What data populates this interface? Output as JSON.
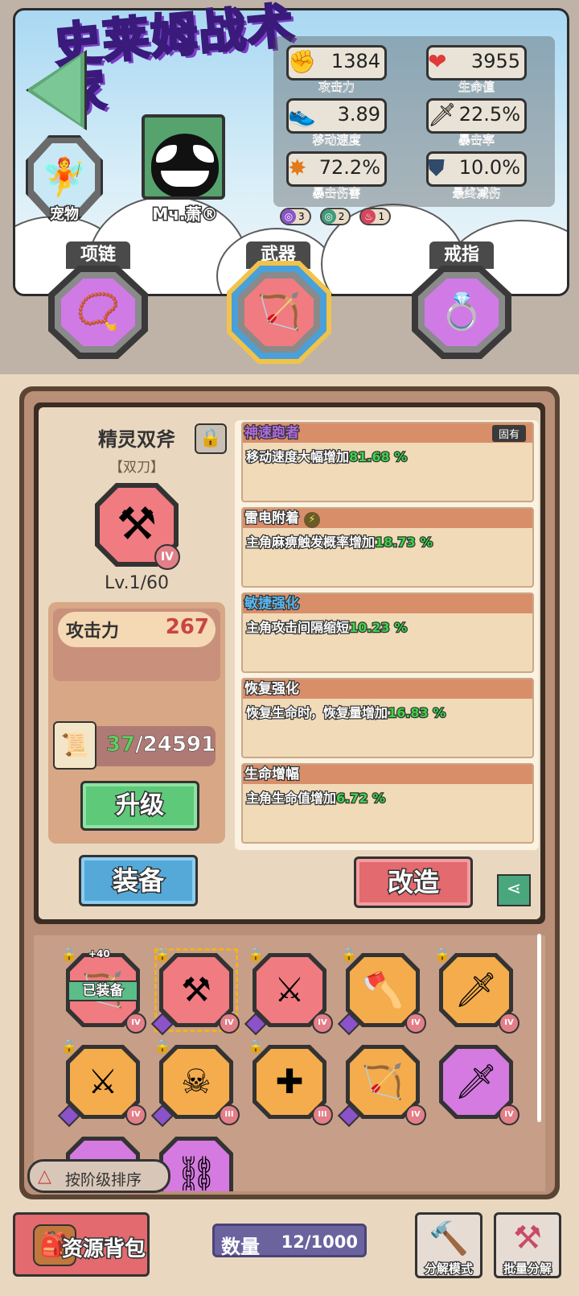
{
  "header": {
    "logo_text": "史莱姆战术家",
    "pet_label": "宠物",
    "player_name": "Mч.萧®"
  },
  "stats": [
    {
      "icon": "fist-icon",
      "value": "1384",
      "label": "攻击力"
    },
    {
      "icon": "heart-icon",
      "value": "3955",
      "label": "生命值"
    },
    {
      "icon": "shoe-icon",
      "value": "3.89",
      "label": "移动速度"
    },
    {
      "icon": "sword-icon",
      "value": "22.5%",
      "label": "暴击率"
    },
    {
      "icon": "explosion-icon",
      "value": "72.2%",
      "label": "暴击伤害"
    },
    {
      "icon": "shield-icon",
      "value": "10.0%",
      "label": "最终减伤"
    }
  ],
  "buffs": [
    {
      "icon": "purple-swirl-icon",
      "count": "3",
      "color": "#8b52c9"
    },
    {
      "icon": "green-swirl-icon",
      "count": "2",
      "color": "#3f9a7a"
    },
    {
      "icon": "fire-icon",
      "count": "1",
      "color": "#d6455d"
    }
  ],
  "equip_slots": [
    {
      "label": "项链",
      "icon": "necklace-icon"
    },
    {
      "label": "武器",
      "icon": "bow-icon"
    },
    {
      "label": "戒指",
      "icon": "ring-icon"
    }
  ],
  "detail": {
    "name": "精灵双斧",
    "type": "【双刀】",
    "tier": "IV",
    "level": "Lv.1/60",
    "attack_label": "攻击力",
    "attack_value": "267",
    "material_have": "37",
    "material_need": "/24591",
    "upgrade_label": "升级",
    "equip_label": "装备",
    "reforge_label": "改造"
  },
  "affixes": [
    {
      "name": "神速跑者",
      "desc": "移动速度大幅增加",
      "value": "81.68 %",
      "tag": "固有",
      "name_color": "#b06ae0"
    },
    {
      "name": "雷电附着",
      "desc": "主角麻痹触发概率增加",
      "value": "18.73 %",
      "tag": "",
      "name_color": "#ffffff"
    },
    {
      "name": "敏捷强化",
      "desc": "主角攻击间隔缩短",
      "value": "10.23 %",
      "tag": "",
      "name_color": "#59b8f0"
    },
    {
      "name": "恢复强化",
      "desc": "恢复生命时，恢复量增加",
      "value": "16.83 %",
      "tag": "",
      "name_color": "#ffffff"
    },
    {
      "name": "生命增幅",
      "desc": "主角生命值增加",
      "value": "6.72 %",
      "tag": "",
      "name_color": "#ffffff"
    }
  ],
  "inventory": [
    {
      "icon": "bow-icon",
      "tier": "IV",
      "bg": "#f07b80",
      "equipped": "已装备",
      "plus": "+40"
    },
    {
      "icon": "axes-icon",
      "tier": "IV",
      "bg": "#f07b80"
    },
    {
      "icon": "green-swords-icon",
      "tier": "IV",
      "bg": "#f07b80"
    },
    {
      "icon": "halberd-icon",
      "tier": "IV",
      "bg": "#f4ac4c"
    },
    {
      "icon": "katana-icon",
      "tier": "IV",
      "bg": "#f4ac4c"
    },
    {
      "icon": "twin-swords-icon",
      "tier": "IV",
      "bg": "#f4ac4c"
    },
    {
      "icon": "sickles-icon",
      "tier": "III",
      "bg": "#f4ac4c"
    },
    {
      "icon": "crossbow-icon",
      "tier": "III",
      "bg": "#f4ac4c"
    },
    {
      "icon": "bow-icon",
      "tier": "IV",
      "bg": "#f4ac4c"
    },
    {
      "icon": "katana-icon",
      "tier": "IV",
      "bg": "#d47ae0"
    },
    {
      "icon": "blades-icon",
      "tier": "",
      "bg": "#d47ae0"
    },
    {
      "icon": "chain-icon",
      "tier": "",
      "bg": "#d47ae0"
    }
  ],
  "sort_label": "按阶级排序",
  "bottom": {
    "bag_label": "资源背包",
    "count_label": "数量",
    "count_value": "12/1000",
    "decompose_mode": "分解模式",
    "batch_decompose": "批量分解"
  }
}
